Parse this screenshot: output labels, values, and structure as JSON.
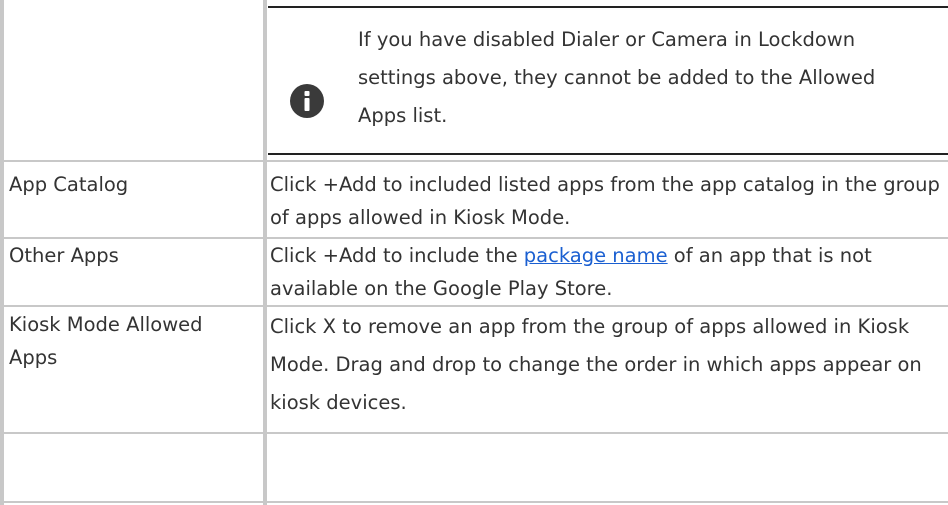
{
  "note": {
    "icon": "info-icon",
    "text": "If you have disabled Dialer or Camera in Lockdown settings above, they cannot be added to the Allowed Apps list."
  },
  "rows": [
    {
      "label": "App Catalog",
      "description": "Click +Add to included listed apps from the app catalog in the group of apps allowed in Kiosk Mode."
    },
    {
      "label": "Other Apps",
      "description_before": "Click +Add to include the ",
      "description_link": "package name",
      "description_after": " of an app that is not available on the Google Play Store."
    },
    {
      "label": "Kiosk Mode Allowed Apps",
      "description": "Click X to remove an app from the group of apps allowed in Kiosk Mode. Drag and drop to change the order in which apps appear on kiosk devices."
    }
  ],
  "colors": {
    "border": "#c8c8c8",
    "rule": "#222222",
    "link": "#1a5fd1",
    "icon": "#3a3a3a"
  }
}
